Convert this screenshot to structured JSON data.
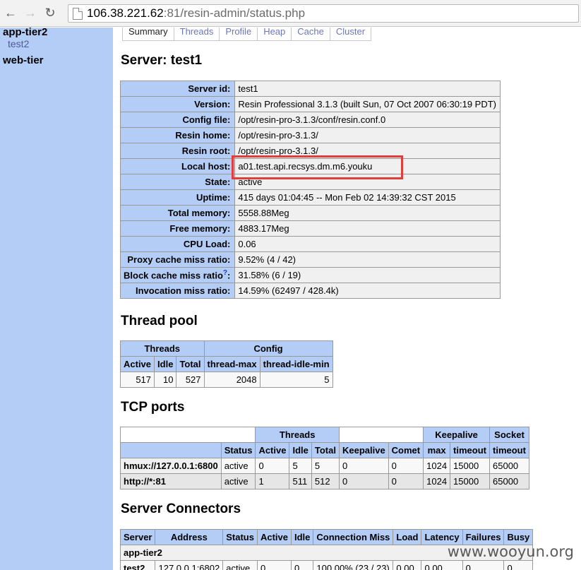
{
  "browser": {
    "url_host": "106.38.221.62",
    "url_rest": ":81/resin-admin/status.php"
  },
  "sidebar": {
    "group1": "app-tier2",
    "group1_link": "test2",
    "group2": "web-tier"
  },
  "tabs": [
    "Summary",
    "Threads",
    "Profile",
    "Heap",
    "Cache",
    "Cluster"
  ],
  "server": {
    "heading": "Server: test1",
    "rows": [
      {
        "label": "Server id:",
        "value": "test1"
      },
      {
        "label": "Version:",
        "value": "Resin Professional 3.1.3 (built Sun, 07 Oct 2007 06:30:19 PDT)"
      },
      {
        "label": "Config file:",
        "value": "/opt/resin-pro-3.1.3/conf/resin.conf.0"
      },
      {
        "label": "Resin home:",
        "value": "/opt/resin-pro-3.1.3/"
      },
      {
        "label": "Resin root:",
        "value": "/opt/resin-pro-3.1.3/"
      },
      {
        "label": "Local host:",
        "value": "a01.test.api.recsys.dm.m6.youku"
      },
      {
        "label": "State:",
        "value": "active"
      },
      {
        "label": "Uptime:",
        "value": "415 days 01:04:45 -- Mon Feb 02 14:39:32 CST 2015"
      },
      {
        "label": "Total memory:",
        "value": "5558.88Meg"
      },
      {
        "label": "Free memory:",
        "value": "4883.17Meg"
      },
      {
        "label": "CPU Load:",
        "value": "0.06"
      },
      {
        "label": "Proxy cache miss ratio:",
        "value": "9.52% (4 / 42)"
      },
      {
        "label": "Block cache miss ratio",
        "sup": "?",
        "suffix": ":",
        "value": "31.58% (6 / 19)"
      },
      {
        "label": "Invocation miss ratio:",
        "value": "14.59% (62497 / 428.4k)"
      }
    ]
  },
  "thread_pool": {
    "heading": "Thread pool",
    "group_headers": [
      "Threads",
      "Config"
    ],
    "headers": [
      "Active",
      "Idle",
      "Total",
      "thread-max",
      "thread-idle-min"
    ],
    "row": [
      "517",
      "10",
      "527",
      "2048",
      "5"
    ]
  },
  "tcp": {
    "heading": "TCP ports",
    "group_headers": [
      "Threads",
      "Keepalive",
      "Socket"
    ],
    "headers": [
      "Status",
      "Active",
      "Idle",
      "Total",
      "Keepalive",
      "Comet",
      "max",
      "timeout",
      "timeout"
    ],
    "rows": [
      [
        "hmux://127.0.0.1:6800",
        "active",
        "0",
        "5",
        "5",
        "0",
        "0",
        "1024",
        "15000",
        "65000"
      ],
      [
        "http://*:81",
        "active",
        "1",
        "511",
        "512",
        "0",
        "0",
        "1024",
        "15000",
        "65000"
      ]
    ]
  },
  "connectors": {
    "heading": "Server Connectors",
    "headers": [
      "Server",
      "Address",
      "Status",
      "Active",
      "Idle",
      "Connection Miss",
      "Load",
      "Latency",
      "Failures",
      "Busy"
    ],
    "group_row": "app-tier2",
    "row": [
      "test2",
      "127.0.0.1:6802",
      "active",
      "0",
      "0",
      "100.00% (23 / 23)",
      "0.00",
      "0.00",
      "0",
      "0"
    ]
  },
  "watermark": "www.wooyun.org",
  "colors": {
    "header_bg": "#b4cdf6",
    "highlight": "#e03d3d"
  }
}
